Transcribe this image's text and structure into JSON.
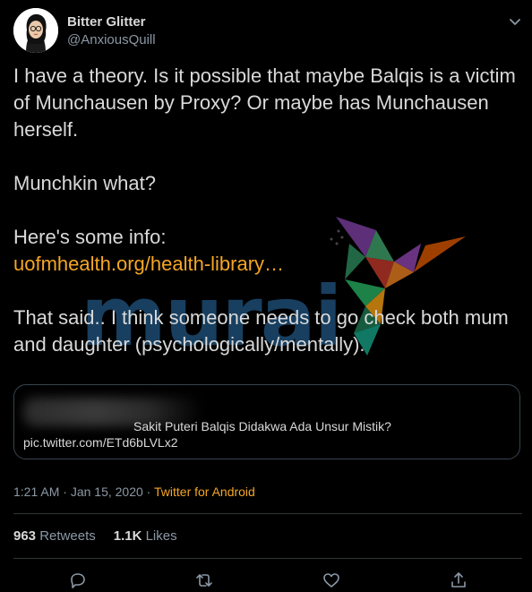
{
  "author": {
    "display_name": "Bitter Glitter",
    "handle": "@AnxiousQuill",
    "avatar_icon": "avatar-cartoon-portrait"
  },
  "tweet": {
    "paragraph_1": "I have a theory. Is it possible that maybe Balqis is a victim of Munchausen by Proxy? Or maybe has Munchausen herself.",
    "paragraph_2": "Munchkin what?",
    "paragraph_3": "Here's some info:",
    "link_text": "uofmhealth.org/health-library…",
    "paragraph_4": "That said.. I think someone needs to go check both mum and daughter (psychologically/mentally)."
  },
  "quote": {
    "title": "Sakit Puteri Balqis Didakwa Ada Unsur Mistik?",
    "link": "pic.twitter.com/ETd6bLVLx2"
  },
  "meta": {
    "time": "1:21 AM",
    "separator_1": " · ",
    "date": "Jan 15, 2020",
    "separator_2": " · ",
    "source": "Twitter for Android"
  },
  "stats": {
    "retweets_count": "963",
    "retweets_label": "Retweets",
    "likes_count": "1.1K",
    "likes_label": "Likes"
  },
  "watermark": {
    "text": "murai"
  },
  "colors": {
    "background": "#000000",
    "text": "#d9d9d9",
    "muted": "#8b98a5",
    "accent": "#f5a623",
    "border": "#38444d"
  },
  "icons": {
    "caret": "chevron-down-icon",
    "reply": "reply-icon",
    "retweet": "retweet-icon",
    "like": "heart-icon",
    "share": "share-icon"
  }
}
